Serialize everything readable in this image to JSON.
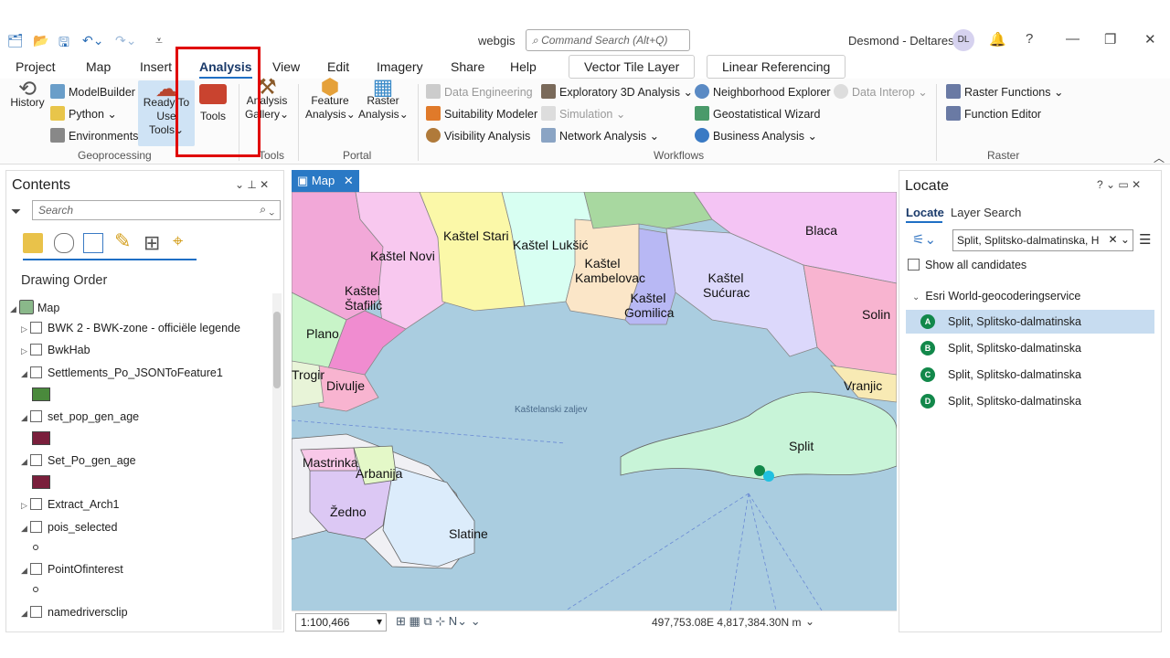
{
  "titlebar": {
    "app_title": "webgis",
    "command_search_placeholder": "Command Search (Alt+Q)",
    "user": "Desmond - Deltares",
    "avatar_initials": "DL",
    "help": "?"
  },
  "tabs": {
    "items": [
      "Project",
      "Map",
      "Insert",
      "Analysis",
      "View",
      "Edit",
      "Imagery",
      "Share",
      "Help"
    ],
    "active": "Analysis",
    "contextual": [
      "Vector Tile Layer",
      "Linear Referencing"
    ]
  },
  "ribbon": {
    "history": "History",
    "modelbuilder": "ModelBuilder",
    "python": "Python",
    "environments": "Environments",
    "ready_to_use_1": "Ready To",
    "ready_to_use_2": "Use Tools",
    "tools": "Tools",
    "analysis_gallery_1": "Analysis",
    "analysis_gallery_2": "Gallery",
    "feature_analysis_1": "Feature",
    "feature_analysis_2": "Analysis",
    "raster_analysis_1": "Raster",
    "raster_analysis_2": "Analysis",
    "data_engineering": "Data Engineering",
    "suitability_modeler": "Suitability Modeler",
    "visibility_analysis": "Visibility Analysis",
    "exploratory_3d": "Exploratory 3D Analysis",
    "simulation": "Simulation",
    "network_analysis": "Network Analysis",
    "neighborhood_explorer": "Neighborhood Explorer",
    "data_interop": "Data Interop",
    "geostatistical_wizard": "Geostatistical Wizard",
    "business_analysis": "Business Analysis",
    "raster_functions": "Raster Functions",
    "function_editor": "Function Editor",
    "groups": {
      "geoprocessing": "Geoprocessing",
      "tools": "Tools",
      "portal": "Portal",
      "workflows": "Workflows",
      "raster": "Raster"
    }
  },
  "contents": {
    "title": "Contents",
    "search_placeholder": "Search",
    "drawing_order": "Drawing Order",
    "map_node": "Map",
    "layers": [
      "BWK 2 - BWK-zone - officiële legende",
      "BwkHab",
      "Settlements_Po_JSONToFeature1",
      "set_pop_gen_age",
      "Set_Po_gen_age",
      "Extract_Arch1",
      "pois_selected",
      "PointOfinterest",
      "namedriversclip"
    ],
    "swatch_colors": {
      "settlements": "#4a8a3c",
      "set_pop": "#7a1f3c",
      "set_po": "#7a1f3c"
    }
  },
  "map": {
    "tab_label": "Map",
    "places": [
      "Kaštel Novi",
      "Kaštel Stari",
      "Kaštel Lukšić",
      "Blaca",
      "Kaštel Kambelovac",
      "Kaštel Sućurac",
      "Kaštel Štafilić",
      "Kaštel Gomilica",
      "Plano",
      "Solin",
      "Trogir",
      "Divulje",
      "Vranjic",
      "Kaštelanski zaljev",
      "Split",
      "Mastrinka",
      "Arbanija",
      "Žedno",
      "Slatine"
    ],
    "scale": "1:100,466",
    "coordinates": "497,753.08E 4,817,384.30N m"
  },
  "locate": {
    "title": "Locate",
    "tab_locate": "Locate",
    "tab_layer_search": "Layer Search",
    "search_value": "Split, Splitsko-dalmatinska, H",
    "show_all": "Show all candidates",
    "provider": "Esri World-geocoderingservice",
    "results": [
      {
        "letter": "A",
        "text": "Split, Splitsko-dalmatinska"
      },
      {
        "letter": "B",
        "text": "Split, Splitsko-dalmatinska"
      },
      {
        "letter": "C",
        "text": "Split, Splitsko-dalmatinska"
      },
      {
        "letter": "D",
        "text": "Split, Splitsko-dalmatinska"
      }
    ]
  }
}
